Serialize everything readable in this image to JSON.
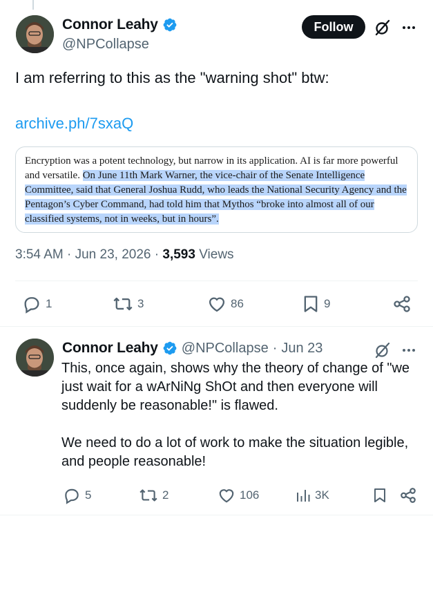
{
  "tweet": {
    "author_name": "Connor Leahy",
    "author_handle": "@NPCollapse",
    "follow_label": "Follow",
    "text": "I am referring to this as the \"warning shot\" btw:",
    "link": "archive.ph/7sxaQ",
    "image_excerpt": {
      "plain": "Encryption was a potent technology, but narrow in its application. AI is far more powerful and versatile. ",
      "highlighted": "On June 11th Mark Warner, the vice-chair of the Senate Intelligence Committee, said that General Joshua Rudd, who leads the National Security Agency and the Pentagon’s Cyber Command, had told him that Mythos “broke into almost all of our classified systems, not in weeks, but in hours”."
    },
    "time": "3:54 AM",
    "date": "Jun 23, 2026",
    "views": "3,593",
    "views_label": "Views",
    "replies": "1",
    "reposts": "3",
    "likes": "86",
    "bookmarks": "9"
  },
  "reply": {
    "author_name": "Connor Leahy",
    "author_handle": "@NPCollapse",
    "date": "Jun 23",
    "paragraph1": "This, once again, shows why the theory of change of \"we just wait for a wArNiNg ShOt and then everyone will suddenly be reasonable!\" is flawed.",
    "paragraph2": "We need to do a lot of work to make the situation legible, and people reasonable!",
    "replies": "5",
    "reposts": "2",
    "likes": "106",
    "views": "3K"
  },
  "colors": {
    "accent": "#1d9bf0",
    "muted": "#536471",
    "text": "#0f1419",
    "highlight": "#b9d5fb"
  }
}
